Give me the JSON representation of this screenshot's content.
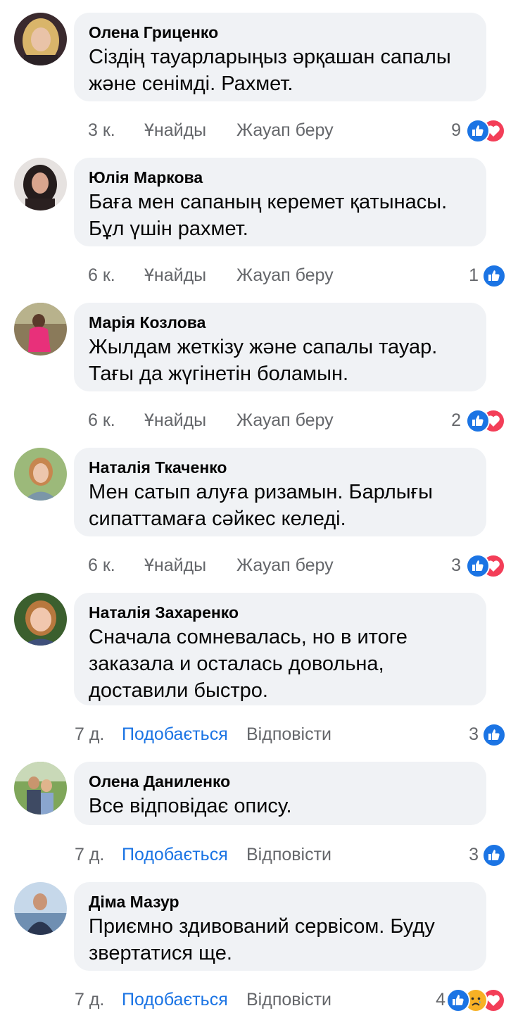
{
  "colors": {
    "bubble": "#f0f2f5",
    "meta": "#65676b",
    "like_blue": "#1b74e4",
    "love_red": "#f33e58"
  },
  "comments": [
    {
      "author": "Олена Гриценко",
      "lines": [
        "Сіздің тауарларыңыз әрқашан сапалы",
        "және сенімді. Рахмет."
      ],
      "time": "3 к.",
      "like_label": "Ұнайды",
      "reply_label": "Жауап беру",
      "reaction_count": "9",
      "reactions": [
        "like-icon",
        "love-icon"
      ],
      "avatar": "woman-blonde-avatar"
    },
    {
      "author": "Юлія Маркова",
      "lines": [
        "Баға мен сапаның керемет қатынасы.",
        "Бұл үшін рахмет."
      ],
      "time": "6 к.",
      "like_label": "Ұнайды",
      "reply_label": "Жауап беру",
      "reaction_count": "1",
      "reactions": [
        "like-icon"
      ],
      "avatar": "woman-dark-hair-avatar"
    },
    {
      "author": "Марія Козлова",
      "lines": [
        "Жылдам жеткізу және сапалы тауар.",
        "Тағы да жүгінетін боламын."
      ],
      "time": "6 к.",
      "like_label": "Ұнайды",
      "reply_label": "Жауап беру",
      "reaction_count": "2",
      "reactions": [
        "like-icon",
        "love-icon"
      ],
      "avatar": "child-pink-avatar"
    },
    {
      "author": "Наталія Ткаченко",
      "lines": [
        "Мен сатып алуға ризамын. Барлығы",
        "сипаттамаға сәйкес келеді."
      ],
      "time": "6 к.",
      "like_label": "Ұнайды",
      "reply_label": "Жауап беру",
      "reaction_count": "3",
      "reactions": [
        "like-icon",
        "love-icon"
      ],
      "avatar": "woman-outdoor-avatar"
    },
    {
      "author": "Наталія Захаренко",
      "lines": [
        "Сначала сомневалась, но в итоге",
        "заказала и осталась довольна,",
        "доставили быстро."
      ],
      "time": "7 д.",
      "like_label": "Подобається",
      "reply_label": "Відповісти",
      "reaction_count": "3",
      "reactions": [
        "like-icon"
      ],
      "avatar": "woman-smiling-avatar"
    },
    {
      "author": "Олена Даниленко",
      "lines": [
        "Все відповідає опису."
      ],
      "time": "7 д.",
      "like_label": "Подобається",
      "reply_label": "Відповісти",
      "reaction_count": "3",
      "reactions": [
        "like-icon"
      ],
      "avatar": "couple-park-avatar"
    },
    {
      "author": "Діма Мазур",
      "lines": [
        "Приємно здивований сервісом. Буду",
        "звертатися ще."
      ],
      "time": "7 д.",
      "like_label": "Подобається",
      "reply_label": "Відповісти",
      "reaction_count": "4",
      "reactions": [
        "like-icon",
        "sad-icon",
        "love-icon"
      ],
      "avatar": "man-lake-avatar"
    }
  ]
}
